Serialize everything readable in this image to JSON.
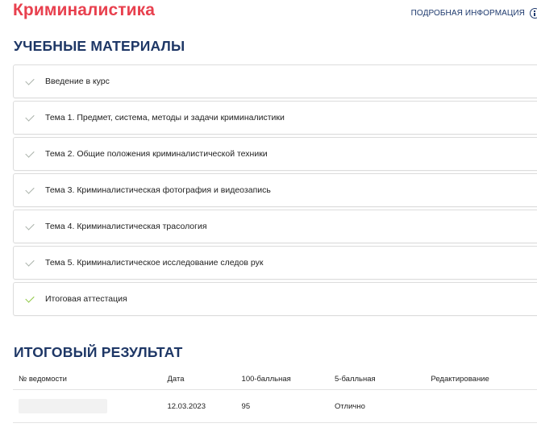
{
  "header": {
    "course_title": "Криминалистика",
    "more_info_label": "ПОДРОБНАЯ ИНФОРМАЦИЯ"
  },
  "materials": {
    "title": "УЧЕБНЫЕ МАТЕРИАЛЫ",
    "items": [
      {
        "label": "Введение в курс",
        "completed": false
      },
      {
        "label": "Тема 1. Предмет, система, методы и задачи криминалистики",
        "completed": false
      },
      {
        "label": "Тема 2. Общие положения криминалистической техники",
        "completed": false
      },
      {
        "label": "Тема 3. Криминалистическая фотография и видеозапись",
        "completed": false
      },
      {
        "label": "Тема 4. Криминалистическая трасология",
        "completed": false
      },
      {
        "label": "Тема 5. Криминалистическое исследование следов рук",
        "completed": false
      },
      {
        "label": "Итоговая аттестация",
        "completed": true
      }
    ]
  },
  "result": {
    "title": "ИТОГОВЫЙ РЕЗУЛЬТАТ",
    "columns": [
      "№ ведомости",
      "Дата",
      "100-балльная",
      "5-балльная",
      "Редактирование"
    ],
    "rows": [
      {
        "date": "12.03.2023",
        "score100": "95",
        "score5": "Отлично",
        "edit": ""
      }
    ]
  },
  "colors": {
    "title_red": "#e8404e",
    "heading_navy": "#1e3766",
    "check_grey": "#a8b0a8",
    "check_green": "#8cc63f"
  }
}
